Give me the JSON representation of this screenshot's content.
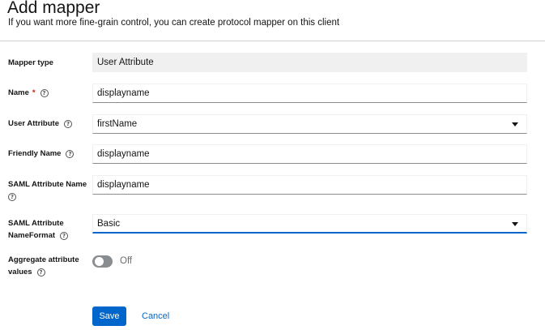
{
  "header": {
    "title": "Add mapper",
    "subtitle": "If you want more fine-grain control, you can create protocol mapper on this client"
  },
  "form": {
    "mapper_type": {
      "label": "Mapper type",
      "value": "User Attribute"
    },
    "name": {
      "label": "Name",
      "required_mark": "*",
      "value": "displayname"
    },
    "user_attribute": {
      "label": "User Attribute",
      "value": "firstName"
    },
    "friendly_name": {
      "label": "Friendly Name",
      "value": "displayname"
    },
    "saml_attribute_name": {
      "label_line1": "SAML Attribute Name",
      "value": "displayname"
    },
    "saml_attribute_nameformat": {
      "label_line1": "SAML Attribute",
      "label_line2": "NameFormat",
      "value": "Basic"
    },
    "aggregate_attribute_values": {
      "label_line1": "Aggregate attribute",
      "label_line2": "values",
      "state_label": "Off",
      "on": false
    }
  },
  "icons": {
    "help": "help-circle-icon",
    "dropdown": "caret-down-icon"
  },
  "actions": {
    "save_label": "Save",
    "cancel_label": "Cancel"
  },
  "colors": {
    "primary": "#0066cc",
    "required": "#c9190b",
    "readonly_bg": "#f0f0f0",
    "toggle_off": "#8a8d90"
  }
}
